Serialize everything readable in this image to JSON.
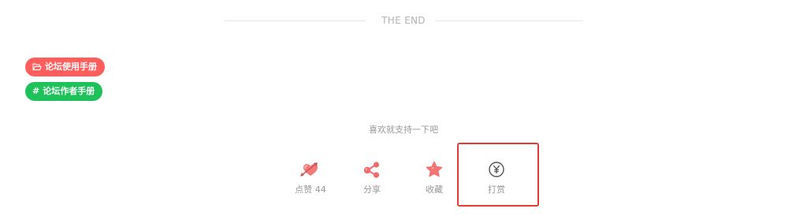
{
  "divider": {
    "text": "THE END"
  },
  "tags": {
    "category": {
      "label": "论坛使用手册",
      "icon": "folder-open-icon"
    },
    "hashtag": {
      "prefix": "#",
      "label": "论坛作者手册"
    }
  },
  "like_prompt": "喜欢就支持一下吧",
  "actions": {
    "like": {
      "label": "点赞",
      "count": "44",
      "icon": "heart-arrow-icon"
    },
    "share": {
      "label": "分享",
      "icon": "share-icon"
    },
    "favorite": {
      "label": "收藏",
      "icon": "star-icon"
    },
    "reward": {
      "label": "打赏",
      "icon": "yen-coin-icon"
    }
  },
  "colors": {
    "category_tag": "#ff5e5c",
    "hashtag_tag": "#1fc25a",
    "icon_accent": "#f26b6b",
    "highlight_border": "#e53935",
    "muted_text": "#999999"
  }
}
